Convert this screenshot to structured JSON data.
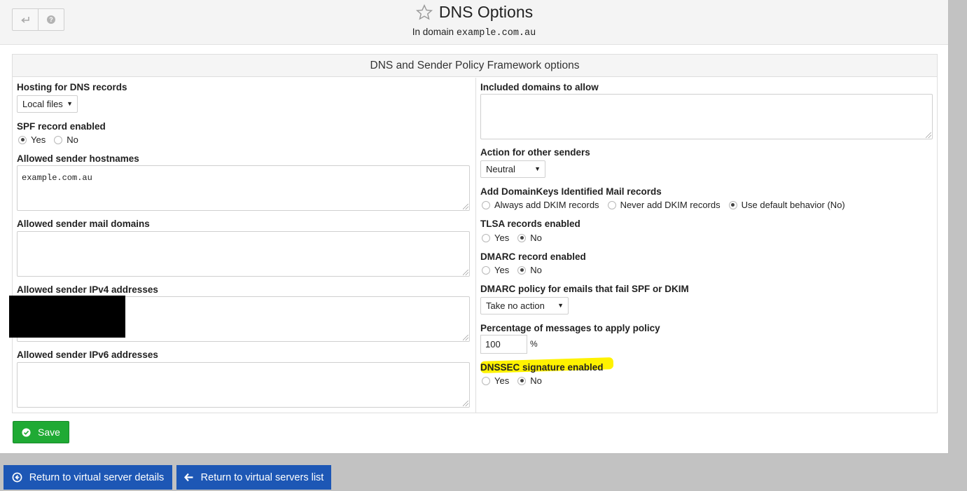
{
  "page": {
    "title": "DNS Options",
    "subtitle_prefix": "In domain",
    "domain": "example.com.au"
  },
  "header": {
    "back_icon": "return-arrow-icon",
    "help_icon": "help-icon",
    "favorite_icon": "star-outline-icon"
  },
  "section": {
    "title": "DNS and Sender Policy Framework options"
  },
  "left": {
    "hosting": {
      "label": "Hosting for DNS records",
      "value": "Local files"
    },
    "spf": {
      "label": "SPF record enabled",
      "options": [
        "Yes",
        "No"
      ],
      "selected": "Yes"
    },
    "sender_hostnames": {
      "label": "Allowed sender hostnames",
      "value": "example.com.au"
    },
    "mail_domains": {
      "label": "Allowed sender mail domains",
      "value": ""
    },
    "ipv4": {
      "label": "Allowed sender IPv4 addresses",
      "value": ""
    },
    "ipv6": {
      "label": "Allowed sender IPv6 addresses",
      "value": ""
    }
  },
  "right": {
    "included_domains": {
      "label": "Included domains to allow",
      "value": ""
    },
    "other_senders": {
      "label": "Action for other senders",
      "value": "Neutral"
    },
    "dkim": {
      "label": "Add DomainKeys Identified Mail records",
      "options": [
        "Always add DKIM records",
        "Never add DKIM records",
        "Use default behavior (No)"
      ],
      "selected": "Use default behavior (No)"
    },
    "tlsa": {
      "label": "TLSA records enabled",
      "options": [
        "Yes",
        "No"
      ],
      "selected": "No"
    },
    "dmarc": {
      "label": "DMARC record enabled",
      "options": [
        "Yes",
        "No"
      ],
      "selected": "No"
    },
    "dmarc_policy": {
      "label": "DMARC policy for emails that fail SPF or DKIM",
      "value": "Take no action"
    },
    "percentage": {
      "label": "Percentage of messages to apply policy",
      "value": "100",
      "unit": "%"
    },
    "dnssec": {
      "label": "DNSSEC signature enabled",
      "options": [
        "Yes",
        "No"
      ],
      "selected": "No"
    }
  },
  "buttons": {
    "save": "Save",
    "return_details": "Return to virtual server details",
    "return_list": "Return to virtual servers list"
  },
  "colors": {
    "save_green": "#1faa34",
    "nav_blue": "#1d57b5",
    "highlight_yellow": "#fff200"
  }
}
